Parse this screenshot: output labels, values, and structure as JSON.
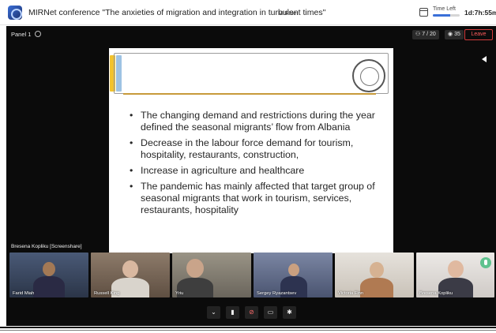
{
  "header": {
    "title": "MIRNet conference \"The anxieties of migration and integration in turbulent times\"",
    "org": "MIRNet",
    "time_left_label": "Time Left",
    "time_left_value": "1d:7h:55m",
    "time_left_fraction": 0.65
  },
  "stage": {
    "panel_label": "Panel 1",
    "people_count": "7 / 20",
    "viewer_count": "35",
    "leave_label": "Leave",
    "screenshare_label": "Bresena Kopliku [Screenshare]"
  },
  "slide": {
    "bullets": [
      "The changing demand and restrictions during the year defined the seasonal migrants’ flow from Albania",
      "Decrease in the labour force demand for tourism, hospitality, restaurants, construction,",
      "Increase in agriculture and healthcare",
      "The pandemic has mainly affected that target group of seasonal migrants that work in tourism, services, restaurants, hospitality"
    ]
  },
  "participants": [
    {
      "name": "Farid Miah"
    },
    {
      "name": "Russell King"
    },
    {
      "name": "Yriu"
    },
    {
      "name": "Sergey Ryazantsev"
    },
    {
      "name": "Victoria Finn"
    },
    {
      "name": "Bresena Kopliku"
    }
  ],
  "controls": {
    "icons": [
      "chevron-down-icon",
      "camera-icon",
      "mic-muted-icon",
      "screen-share-icon",
      "settings-icon"
    ]
  },
  "colors": {
    "leave": "#d23b3b",
    "active_speaker": "#5fc28e",
    "accent": "#3a6fd8"
  }
}
